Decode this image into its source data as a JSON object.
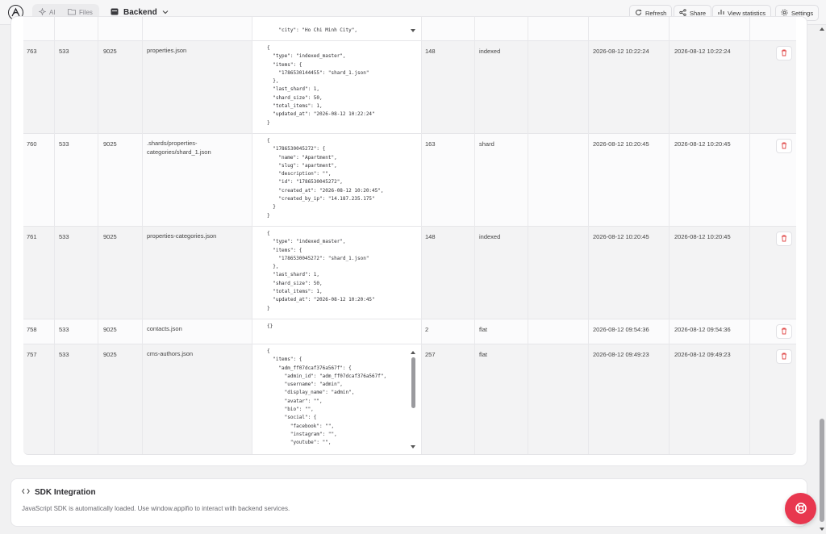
{
  "topbar": {
    "tabs": [
      {
        "label": "AI"
      },
      {
        "label": "Files"
      }
    ],
    "app_name": "Backend",
    "buttons": {
      "refresh": "Refresh",
      "share": "Share",
      "stats": "View statistics",
      "settings": "Settings"
    }
  },
  "prev_row_tail": "    \"city\": \"Ho Chi Minh City\",",
  "rows": [
    {
      "id": "763",
      "owner": "533",
      "app": "9025",
      "path": "properties.json",
      "json": "{\n  \"type\": \"indexed_master\",\n  \"items\": {\n    \"1786530144455\": \"shard_1.json\"\n  },\n  \"last_shard\": 1,\n  \"shard_size\": 50,\n  \"total_items\": 1,\n  \"updated_at\": \"2026-08-12 10:22:24\"\n}",
      "size": "148",
      "type": "indexed",
      "created": "2026-08-12 10:22:24",
      "updated": "2026-08-12 10:22:24"
    },
    {
      "id": "760",
      "owner": "533",
      "app": "9025",
      "path": ".shards/properties-categories/shard_1.json",
      "json": "{\n  \"1786530045272\": {\n    \"name\": \"Apartment\",\n    \"slug\": \"apartment\",\n    \"description\": \"\",\n    \"id\": \"1786530045272\",\n    \"created_at\": \"2026-08-12 10:20:45\",\n    \"created_by_ip\": \"14.187.235.175\"\n  }\n}",
      "size": "163",
      "type": "shard",
      "created": "2026-08-12 10:20:45",
      "updated": "2026-08-12 10:20:45"
    },
    {
      "id": "761",
      "owner": "533",
      "app": "9025",
      "path": "properties-categories.json",
      "json": "{\n  \"type\": \"indexed_master\",\n  \"items\": {\n    \"1786530045272\": \"shard_1.json\"\n  },\n  \"last_shard\": 1,\n  \"shard_size\": 50,\n  \"total_items\": 1,\n  \"updated_at\": \"2026-08-12 10:20:45\"\n}",
      "size": "148",
      "type": "indexed",
      "created": "2026-08-12 10:20:45",
      "updated": "2026-08-12 10:20:45"
    },
    {
      "id": "758",
      "owner": "533",
      "app": "9025",
      "path": "contacts.json",
      "json": "{}",
      "size": "2",
      "type": "flat",
      "created": "2026-08-12 09:54:36",
      "updated": "2026-08-12 09:54:36"
    },
    {
      "id": "757",
      "owner": "533",
      "app": "9025",
      "path": "cms-authors.json",
      "json": "{\n  \"items\": {\n    \"adm_ff07dcaf376a567f\": {\n      \"admin_id\": \"adm_ff07dcaf376a567f\",\n      \"username\": \"admin\",\n      \"display_name\": \"admin\",\n      \"avatar\": \"\",\n      \"bio\": \"\",\n      \"social\": {\n        \"facebook\": \"\",\n        \"instagram\": \"\",\n        \"youtube\": \"\",",
      "size": "257",
      "type": "flat",
      "created": "2026-08-12 09:49:23",
      "updated": "2026-08-12 09:49:23"
    }
  ],
  "sdk": {
    "title": "SDK Integration",
    "description": "JavaScript SDK is automatically loaded. Use window.appifio to interact with backend services."
  },
  "icons": {
    "logo": "app-logo-icon",
    "ai": "sparkle-icon",
    "files": "folder-icon",
    "app": "database-icon",
    "refresh": "refresh-icon",
    "share": "share-icon",
    "stats": "bar-chart-icon",
    "settings": "gear-icon",
    "delete": "trash-icon",
    "code": "code-icon",
    "help": "lifebuoy-icon"
  },
  "colors": {
    "accent": "#e8374f",
    "delete": "#e04848"
  }
}
